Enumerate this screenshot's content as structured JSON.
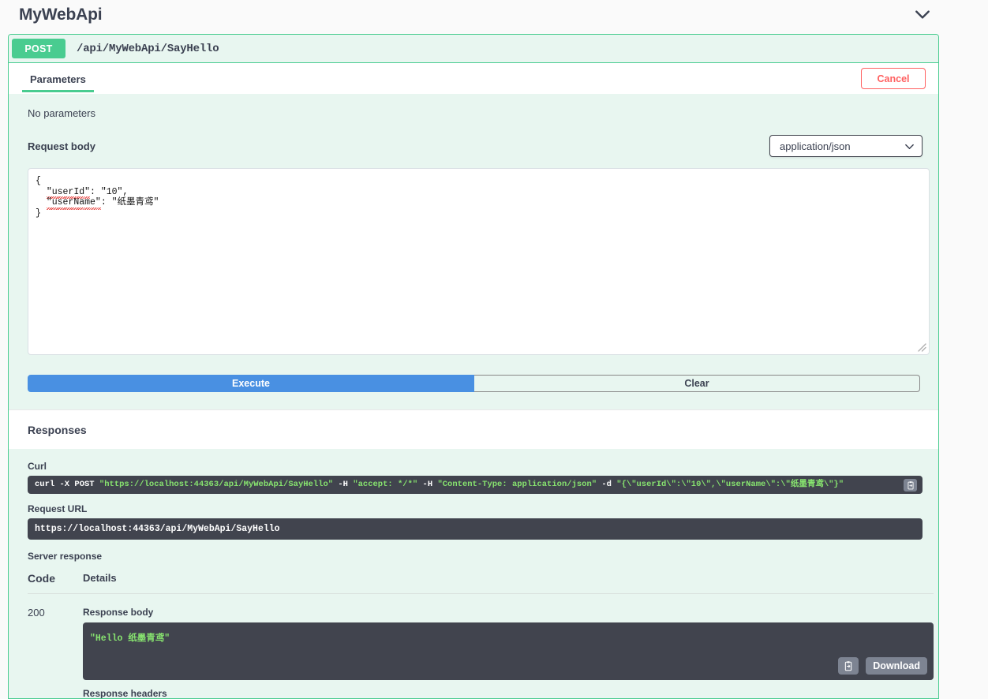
{
  "header": {
    "title": "MyWebApi",
    "collapse_icon": "chevron-down-icon"
  },
  "operation": {
    "method": "POST",
    "path": "/api/MyWebApi/SayHello"
  },
  "tabs": {
    "parameters_label": "Parameters",
    "cancel_label": "Cancel"
  },
  "parameters": {
    "empty_text": "No parameters"
  },
  "request_body": {
    "label": "Request body",
    "content_type": "application/json",
    "content_type_options": [
      "application/json"
    ],
    "dropdown_icon": "chevron-down-icon",
    "editor_line_1": "{",
    "editor_key_1": "\"userId\"",
    "editor_rest_1": ": \"10\",",
    "editor_key_2": "\"userName\"",
    "editor_rest_2": ": \"纸墨青鸢\"",
    "editor_line_4": "}",
    "resize_icon": "resize-grip-icon"
  },
  "actions": {
    "execute_label": "Execute",
    "clear_label": "Clear"
  },
  "responses": {
    "section_title": "Responses",
    "curl_label": "Curl",
    "curl_command_part1": "curl -X POST ",
    "curl_url": "\"https://localhost:44363/api/MyWebApi/SayHello\"",
    "curl_h1": " -H  ",
    "curl_accept": "\"accept: */*\"",
    "curl_h2": " -H  ",
    "curl_ctype": "\"Content-Type: application/json\"",
    "curl_d": " -d ",
    "curl_data": "\"{\\\"userId\\\":\\\"10\\\",\\\"userName\\\":\\\"纸墨青鸢\\\"}\"",
    "request_url_label": "Request URL",
    "request_url": "https://localhost:44363/api/MyWebApi/SayHello",
    "server_response_label": "Server response",
    "col_code": "Code",
    "col_details": "Details",
    "code_value": "200",
    "response_body_label": "Response body",
    "response_body_text": "\"Hello 纸墨青鸢\"",
    "copy_icon": "clipboard-copy-icon",
    "download_label": "Download",
    "response_headers_label": "Response headers"
  }
}
